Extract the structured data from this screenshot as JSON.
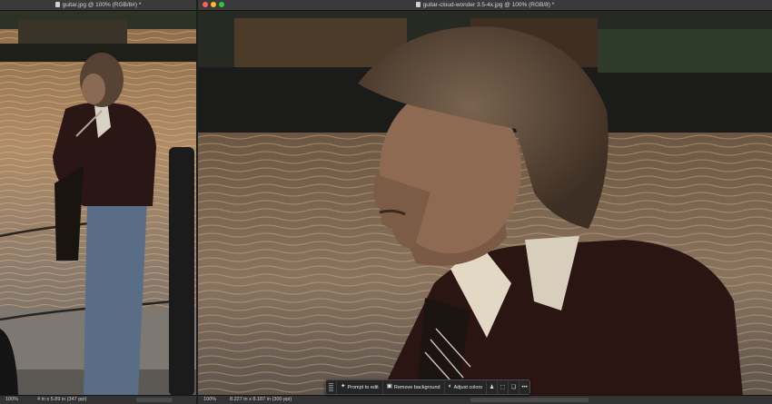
{
  "left_window": {
    "title": "guitar.jpg @ 100% (RGB/8#) *",
    "zoom": "100%",
    "doc_info": "4 in x 5.89 in (347 ppi)"
  },
  "right_window": {
    "title": "guitar-cloud-wonder 3.5-4x.jpg @ 100% (RGB/8) *",
    "zoom": "100%",
    "doc_info": "8.227 in x 8.187 in (300 ppi)"
  },
  "traffic_lights": {
    "close": "#ff5f57",
    "minimize": "#febc2e",
    "zoom": "#28c840"
  },
  "contextual_taskbar": {
    "prompt_label": "Prompt to edit",
    "remove_bg_label": "Remove background",
    "adjust_colors_label": "Adjust colors",
    "more_label": "•••"
  }
}
